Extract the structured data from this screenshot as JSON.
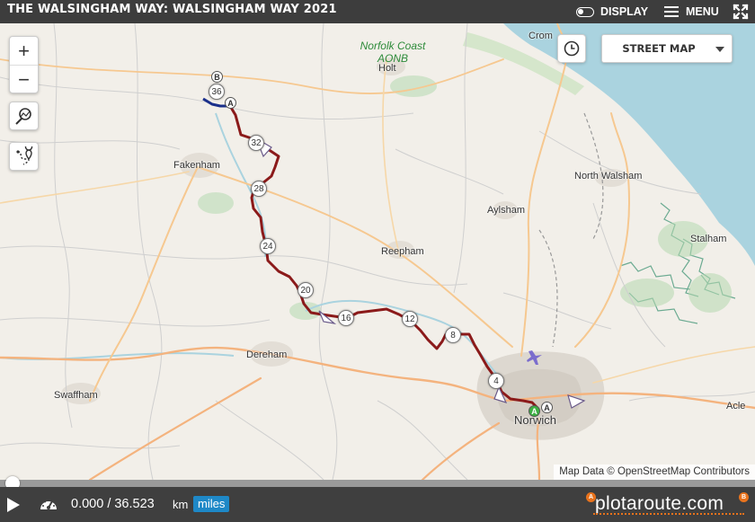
{
  "header": {
    "title": "THE WALSINGHAM WAY: WALSINGHAM WAY 2021",
    "display_label": "DISPLAY",
    "menu_label": "MENU"
  },
  "map": {
    "map_type_selected": "STREET MAP",
    "attribution": "Map Data © OpenStreetMap Contributors",
    "places": {
      "cromer": "Crom",
      "aonb": "Norfolk Coast AONB",
      "holt": "Holt",
      "fakenham": "Fakenham",
      "north_walsham": "North Walsham",
      "aylsham": "Aylsham",
      "stalham": "Stalham",
      "reepham": "Reepham",
      "dereham": "Dereham",
      "swaffham": "Swaffham",
      "norwich": "Norwich",
      "acle": "Acle"
    },
    "distance_markers": [
      "36",
      "32",
      "28",
      "24",
      "20",
      "16",
      "12",
      "8",
      "4"
    ],
    "start_pin": "A",
    "end_pin": "B",
    "route_color": "#8b1a1a",
    "route_start_color": "#1a2f8b"
  },
  "player": {
    "progress": 0.0,
    "distance_text": "0.000 / 36.523",
    "unit_km": "km",
    "unit_miles": "miles",
    "selected_unit": "miles"
  },
  "brand": {
    "name": "plotaroute.com",
    "accent": "#e8721c"
  },
  "icons": [
    "toggle-icon",
    "hamburger-icon",
    "fullscreen-icon",
    "zoom-in-icon",
    "zoom-out-icon",
    "zoom-to-route-icon",
    "route-pin-icon",
    "clock-icon",
    "caret-down-icon",
    "play-icon",
    "speedometer-icon"
  ]
}
